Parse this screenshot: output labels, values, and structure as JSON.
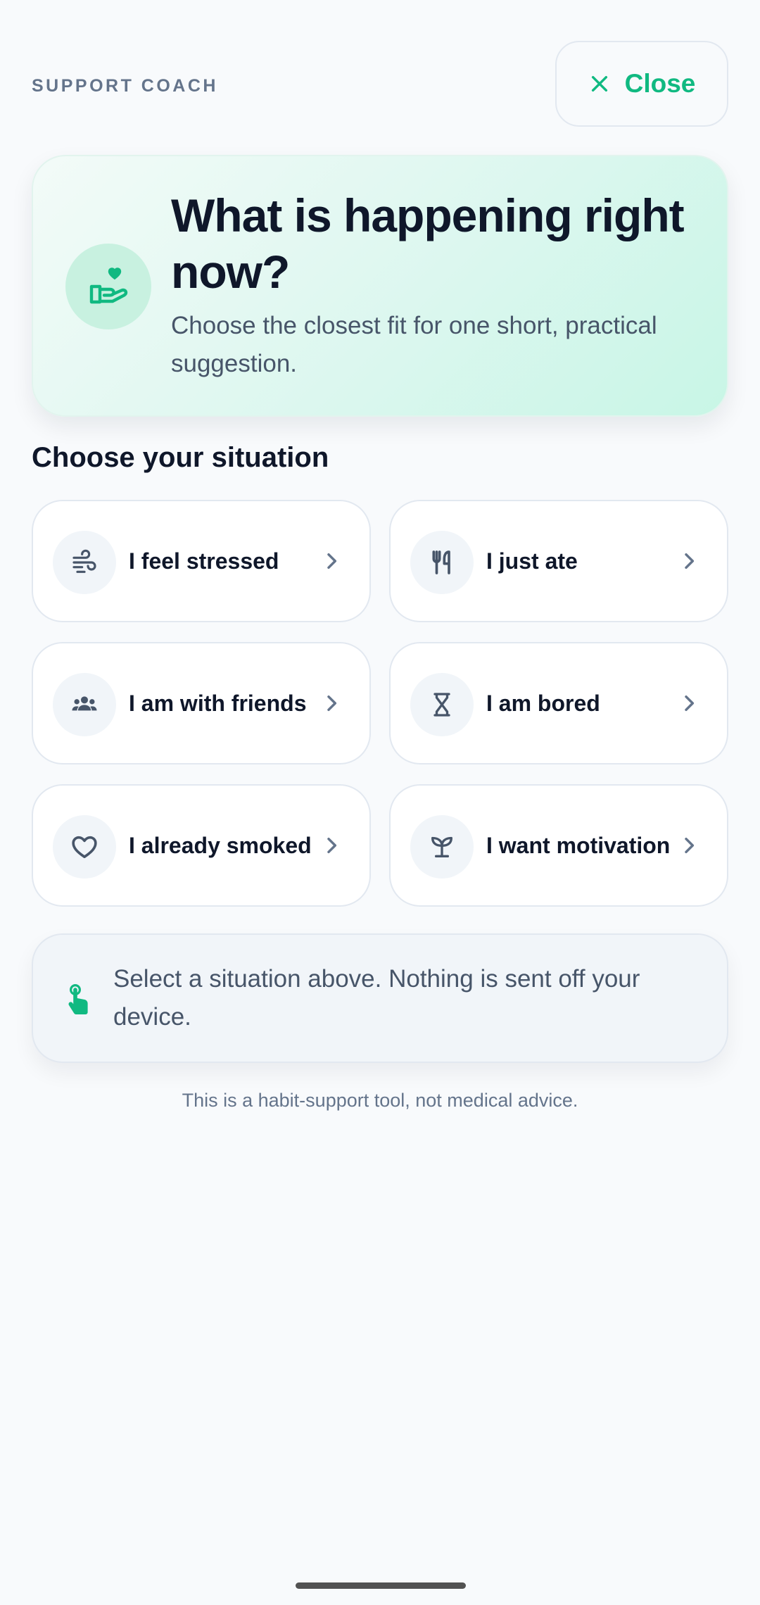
{
  "header": {
    "eyebrow": "SUPPORT COACH",
    "close_label": "Close",
    "close_icon": "close-icon"
  },
  "hero": {
    "icon": "heart-in-hand-icon",
    "title": "What is happening right now?",
    "subtitle": "Choose the closest fit for one short, practical suggestion."
  },
  "section_title": "Choose your situation",
  "situations": [
    {
      "label": "I feel stressed",
      "icon": "wind-icon"
    },
    {
      "label": "I just ate",
      "icon": "utensils-icon"
    },
    {
      "label": "I am with friends",
      "icon": "people-icon"
    },
    {
      "label": "I am bored",
      "icon": "hourglass-icon"
    },
    {
      "label": "I already smoked",
      "icon": "heart-icon"
    },
    {
      "label": "I want motivation",
      "icon": "sprout-icon"
    }
  ],
  "notice": {
    "icon": "tap-icon",
    "text": "Select a situation above. Nothing is sent off your device."
  },
  "disclaimer": "This is a habit-support tool, not medical advice.",
  "colors": {
    "accent": "#10b981",
    "text": "#0f172a",
    "muted": "#64748b",
    "background": "#f8fafc"
  }
}
